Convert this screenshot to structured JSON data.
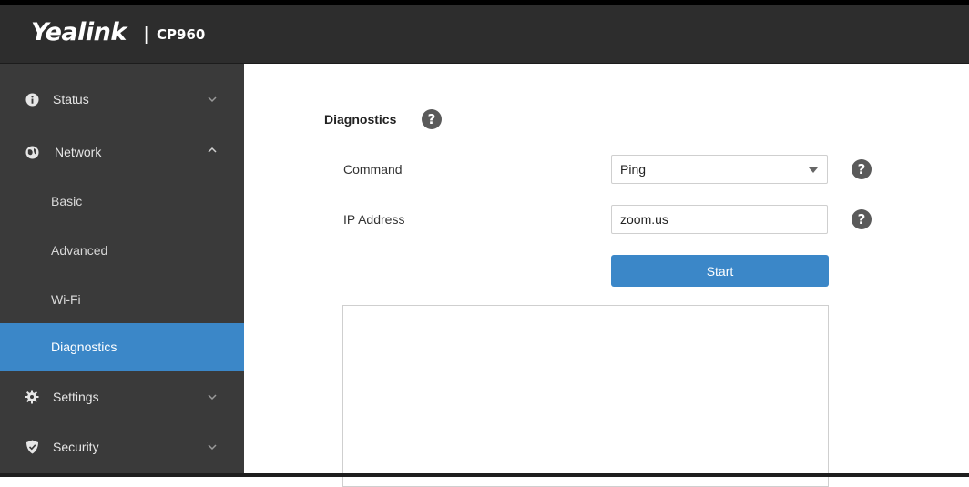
{
  "header": {
    "brand": "Yealink",
    "separator": "|",
    "model": "CP960"
  },
  "sidebar": {
    "items": [
      {
        "label": "Status",
        "icon": "info-icon",
        "expanded": false
      },
      {
        "label": "Network",
        "icon": "globe-icon",
        "expanded": true
      },
      {
        "label": "Basic"
      },
      {
        "label": "Advanced"
      },
      {
        "label": "Wi-Fi"
      },
      {
        "label": "Diagnostics",
        "active": true
      },
      {
        "label": "Settings",
        "icon": "gear-icon",
        "expanded": false
      },
      {
        "label": "Security",
        "icon": "shield-icon",
        "expanded": false
      }
    ]
  },
  "main": {
    "title": "Diagnostics",
    "command": {
      "label": "Command",
      "value": "Ping"
    },
    "ip_address": {
      "label": "IP Address",
      "value": "zoom.us"
    },
    "start_label": "Start",
    "output_text": ""
  },
  "help_glyph": "?",
  "colors": {
    "header_bg": "#2d2d2d",
    "sidebar_bg": "#3a3a3a",
    "accent": "#3b87c8"
  }
}
